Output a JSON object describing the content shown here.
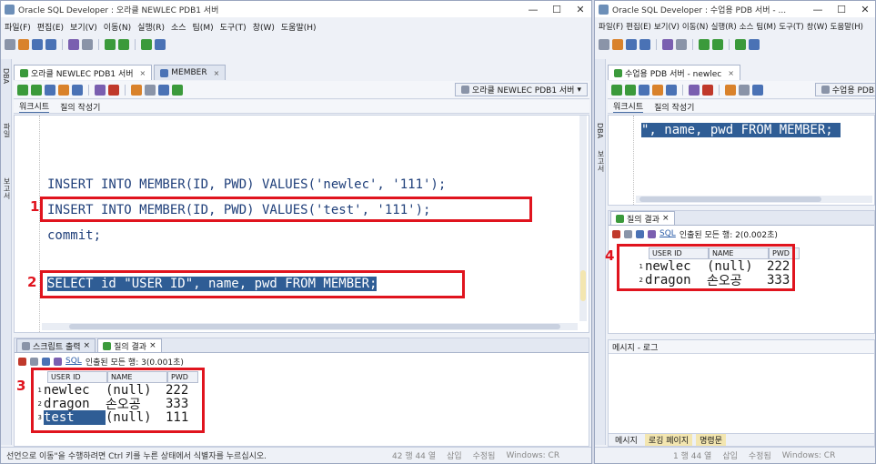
{
  "left_window": {
    "title": "Oracle SQL Developer : 오라클 NEWLEC PDB1 서버",
    "menu": [
      "파일(F)",
      "편집(E)",
      "보기(V)",
      "이동(N)",
      "실행(R)",
      "소스",
      "팀(M)",
      "도구(T)",
      "창(W)",
      "도움말(H)"
    ],
    "vertical_labels": [
      "DBA",
      "파일",
      "보고서"
    ],
    "editor_tabs": [
      {
        "label": "오라클 NEWLEC PDB1 서버",
        "close": "×"
      },
      {
        "label": "MEMBER",
        "close": "×"
      }
    ],
    "connection": "오라클 NEWLEC PDB1 서버",
    "sub_tabs": [
      "워크시트",
      "질의 작성기"
    ],
    "code_lines": [
      "INSERT INTO MEMBER(ID, PWD) VALUES('newlec', '111');",
      "INSERT INTO MEMBER(ID, PWD) VALUES('test', '111');",
      "commit;",
      "SELECT id \"USER ID\", name, pwd FROM MEMBER;"
    ],
    "labels": [
      "1",
      "2",
      "3"
    ],
    "result_tabs": [
      {
        "label": "스크립트 출력",
        "close": "×"
      },
      {
        "label": "질의 결과",
        "close": "×"
      }
    ],
    "result_toolbar": {
      "sql": "SQL",
      "status": "인출된 모든 행: 3(0.001초)"
    },
    "columns": [
      "USER ID",
      "NAME",
      "PWD"
    ],
    "rows": [
      {
        "n": "1",
        "id": "newlec",
        "name": "(null)",
        "pwd": "222"
      },
      {
        "n": "2",
        "id": "dragon",
        "name": "손오공",
        "pwd": "333"
      },
      {
        "n": "3",
        "id": "test",
        "name": "(null)",
        "pwd": "111"
      }
    ],
    "statusbar": {
      "hint": "선언으로 이동\"을 수행하려면 Ctrl 키를 누른 상태에서 식별자를 누르십시오.",
      "pos": "42 행 44 열",
      "mode": "삽입",
      "modified": "수정됨",
      "os": "Windows: CR"
    }
  },
  "right_window": {
    "title": "Oracle SQL Developer : 수업용 PDB 서버 - ...",
    "menu": [
      "파일(F)",
      "편집(E)",
      "보기(V)",
      "이동(N)",
      "실행(R)",
      "소스",
      "팀(M)",
      "도구(T)",
      "창(W)",
      "도움말(H)"
    ],
    "vertical_labels": [
      "DBA",
      "보고서"
    ],
    "editor_tabs": [
      {
        "label": "수업용 PDB 서버 - newlec",
        "close": "×"
      }
    ],
    "connection": "수업용 PDB",
    "sub_tabs": [
      "워크시트",
      "질의 작성기"
    ],
    "code_line": "\", name, pwd FROM MEMBER;",
    "label": "4",
    "result_tabs": [
      {
        "label": "질의 결과",
        "close": "×"
      }
    ],
    "result_toolbar": {
      "sql": "SQL",
      "status": "인출된 모든 행: 2(0.002초)"
    },
    "columns": [
      "USER ID",
      "NAME",
      "PWD"
    ],
    "rows": [
      {
        "n": "1",
        "id": "newlec",
        "name": "(null)",
        "pwd": "222"
      },
      {
        "n": "2",
        "id": "dragon",
        "name": "손오공",
        "pwd": "333"
      }
    ],
    "log_panel": {
      "title": "메시지 - 로그",
      "tabs": [
        "메시지",
        "로깅 페이지",
        "명령문"
      ]
    },
    "statusbar": {
      "pos": "1 행 44 열",
      "mode": "삽입",
      "modified": "수정됨",
      "os": "Windows: CR"
    }
  },
  "window_controls": {
    "minimize": "—",
    "maximize": "☐",
    "close": "✕"
  }
}
